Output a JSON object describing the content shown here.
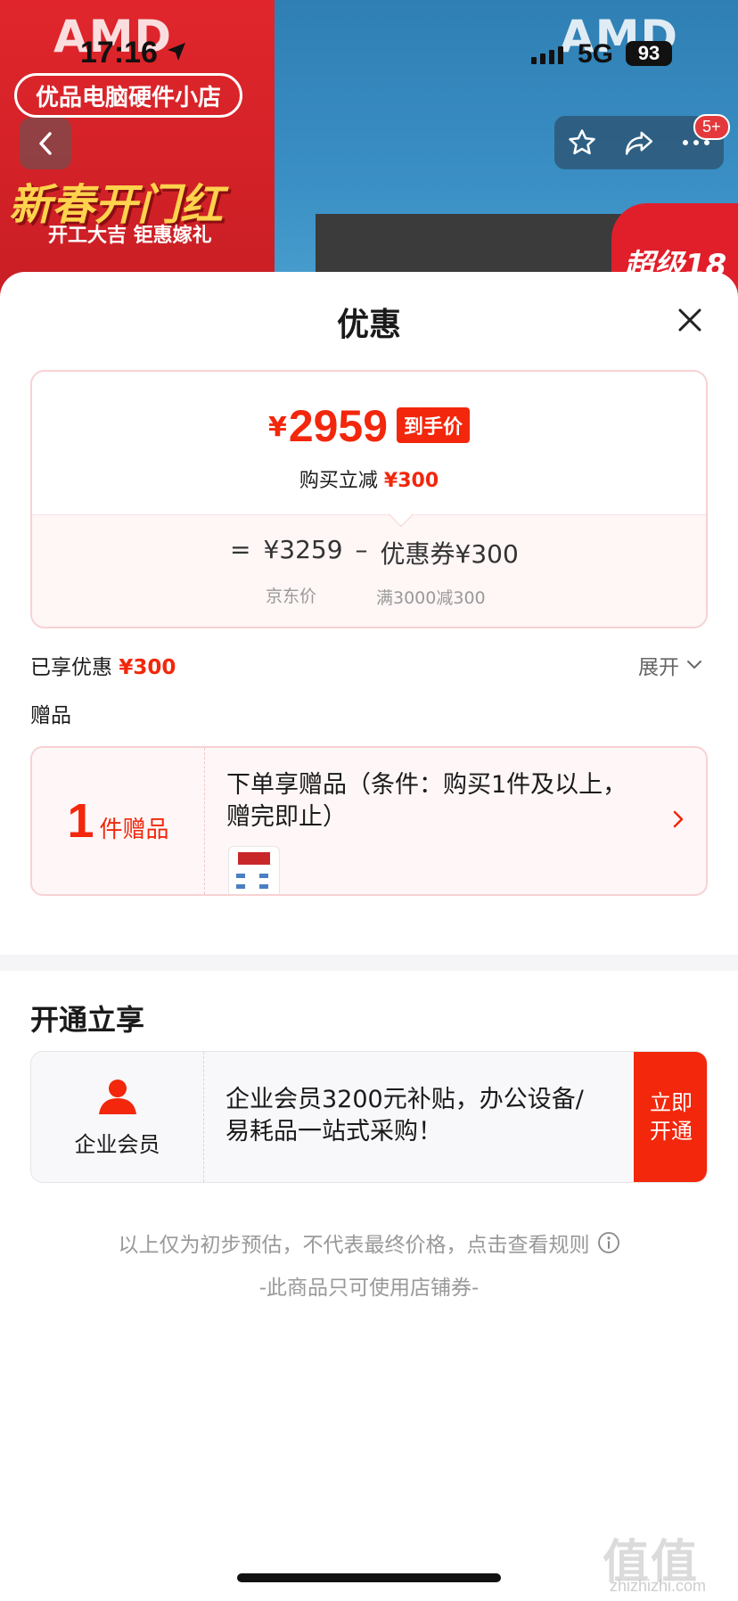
{
  "status_bar": {
    "time": "17:16",
    "network": "5G",
    "battery": "93"
  },
  "background": {
    "brand_left": "AMD",
    "brand_right": "AMD",
    "store_name": "优品电脑硬件小店",
    "promo_title": "新春开门红",
    "promo_sub": "开工大吉 钜惠嫁礼",
    "promo_right": "超级18"
  },
  "nav": {
    "badge": "5+"
  },
  "sheet": {
    "title": "优惠",
    "price_card": {
      "currency": "¥",
      "final_price": "2959",
      "final_tag": "到手价",
      "reduce_label": "购买立减",
      "reduce_value": "¥300",
      "eq_sign": "=",
      "jd_price": "¥3259",
      "minus_sign": "–",
      "coupon": "优惠券¥300",
      "jd_label": "京东价",
      "coupon_rule": "满3000减300"
    },
    "enjoyed": {
      "label": "已享优惠",
      "value": "¥300",
      "expand": "展开"
    },
    "gift": {
      "section_title": "赠品",
      "count": "1",
      "unit": "件赠品",
      "description": "下单享赠品（条件：购买1件及以上，赠完即止）"
    },
    "membership": {
      "section_title": "开通立享",
      "label": "企业会员",
      "description": "企业会员3200元补贴，办公设备/易耗品一站式采购！",
      "button": "立即开通"
    },
    "footnote": "以上仅为初步预估，不代表最终价格，点击查看规则",
    "footnote2": "-此商品只可使用店铺券-"
  },
  "watermark": {
    "main": "值值值",
    "url": "zhizhizhi.com"
  },
  "colors": {
    "accent": "#f2270c",
    "card_border": "#f7d2d4"
  }
}
